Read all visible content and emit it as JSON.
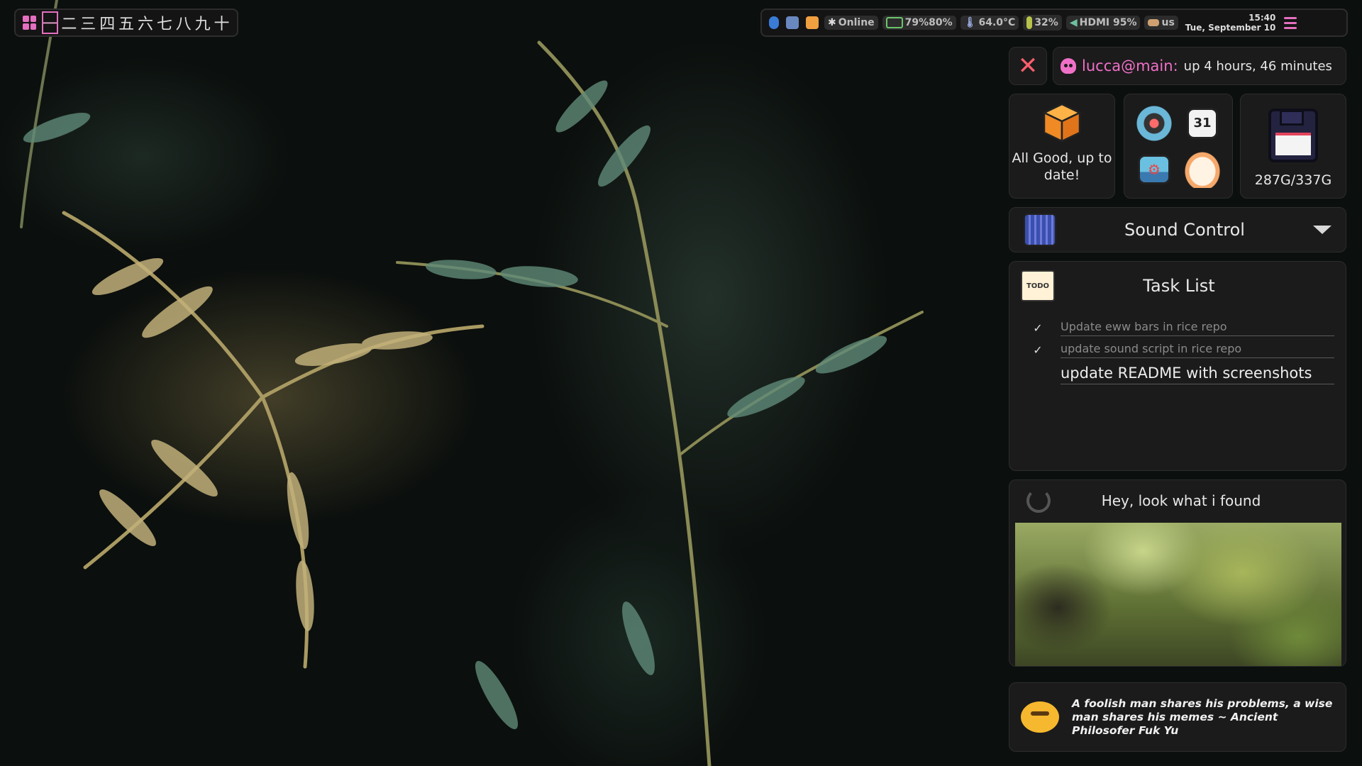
{
  "workspaces": {
    "items": [
      "一",
      "二",
      "三",
      "四",
      "五",
      "六",
      "七",
      "八",
      "九",
      "十"
    ],
    "active_index": 0
  },
  "topbar": {
    "network_status": "Online",
    "battery": "79%80%",
    "temperature": "64.0°C",
    "cpu": "32%",
    "volume": "HDMI 95%",
    "keyboard_layout": "us",
    "time": "15:40",
    "date": "Tue, September 10"
  },
  "user": {
    "name": "lucca@main:",
    "uptime": "up 4 hours, 46 minutes"
  },
  "updates": {
    "status": "All Good, up to date!"
  },
  "disk": {
    "usage": "287G/337G"
  },
  "sound": {
    "title": "Sound Control"
  },
  "tasks": {
    "title": "Task List",
    "items": [
      {
        "text": "Update eww bars in rice repo",
        "done": true
      },
      {
        "text": "update sound script in rice repo",
        "done": true
      },
      {
        "text": "update README with screenshots",
        "done": false
      }
    ]
  },
  "found": {
    "title": "Hey, look what i found"
  },
  "quote": {
    "text": "A foolish man shares his problems, a wise man shares his memes ~ Ancient Philosofer Fuk Yu"
  },
  "icons": {
    "launcher": "grid-icon",
    "bluetooth": "bluetooth-icon",
    "display": "monitor-icon",
    "temperature": "thermometer-icon",
    "volume": "speaker-icon",
    "keyboard": "keyboard-icon",
    "menu": "hamburger-menu-icon",
    "close": "close-icon",
    "user": "skull-icon",
    "updates": "package-box-icon",
    "disk": "floppy-disk-icon",
    "sound": "mixer-icon",
    "tasks": "todo-note-icon",
    "refresh": "refresh-icon",
    "quote": "thinking-emoji-icon"
  },
  "colors": {
    "accent": "#e46fbf",
    "close": "#ff5e6e",
    "panel_bg": "#1b1b1b"
  }
}
